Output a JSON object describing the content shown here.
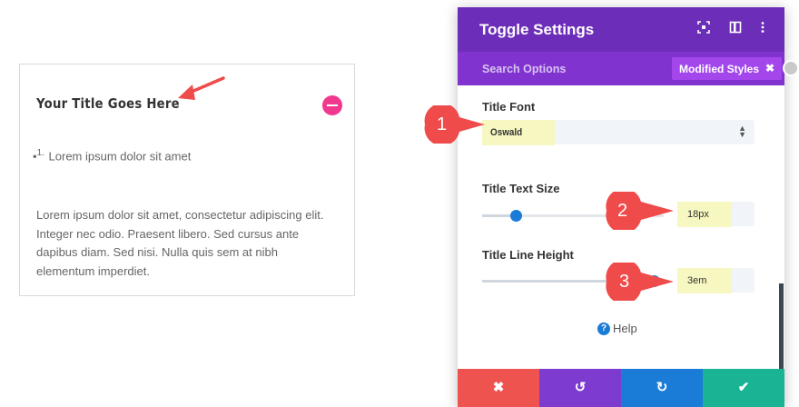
{
  "preview": {
    "title": "Your Title Goes Here",
    "list_marker": "1.",
    "list_item": "Lorem ipsum dolor sit amet",
    "body_lines": [
      "Lorem ipsum dolor sit amet, consectetur adipiscing elit.",
      "Integer nec odio. Praesent libero. Sed cursus ante",
      "dapibus diam. Sed nisi. Nulla quis sem at nibh",
      "elementum imperdiet."
    ]
  },
  "panel": {
    "title": "Toggle Settings",
    "search_options": "Search Options",
    "modified_styles": "Modified Styles",
    "modified_close": "✖",
    "header_icons": [
      "expand-icon",
      "columns-icon",
      "more-icon"
    ],
    "fields": {
      "title_font_label": "Title Font",
      "title_font_value": "Oswald",
      "title_text_size_label": "Title Text Size",
      "title_text_size_value": "18px",
      "title_line_height_label": "Title Line Height",
      "title_line_height_value": "3em"
    },
    "help_label": "Help",
    "footer": {
      "cancel": "✖",
      "undo": "↺",
      "redo": "↻",
      "save": "✔"
    }
  },
  "callouts": [
    "1",
    "2",
    "3"
  ],
  "colors": {
    "header": "#6c2eb9",
    "subbar": "#8133d0",
    "modified_badge": "#a347ed",
    "toggle_icon": "#f0388f",
    "slider_knob": "#1a7cd6",
    "cancel": "#ef5350",
    "undo": "#7e3bd0",
    "redo": "#1a7cd6",
    "save": "#1ab394",
    "callout": "#ef4b4b",
    "highlight": "#f7f7c1"
  }
}
